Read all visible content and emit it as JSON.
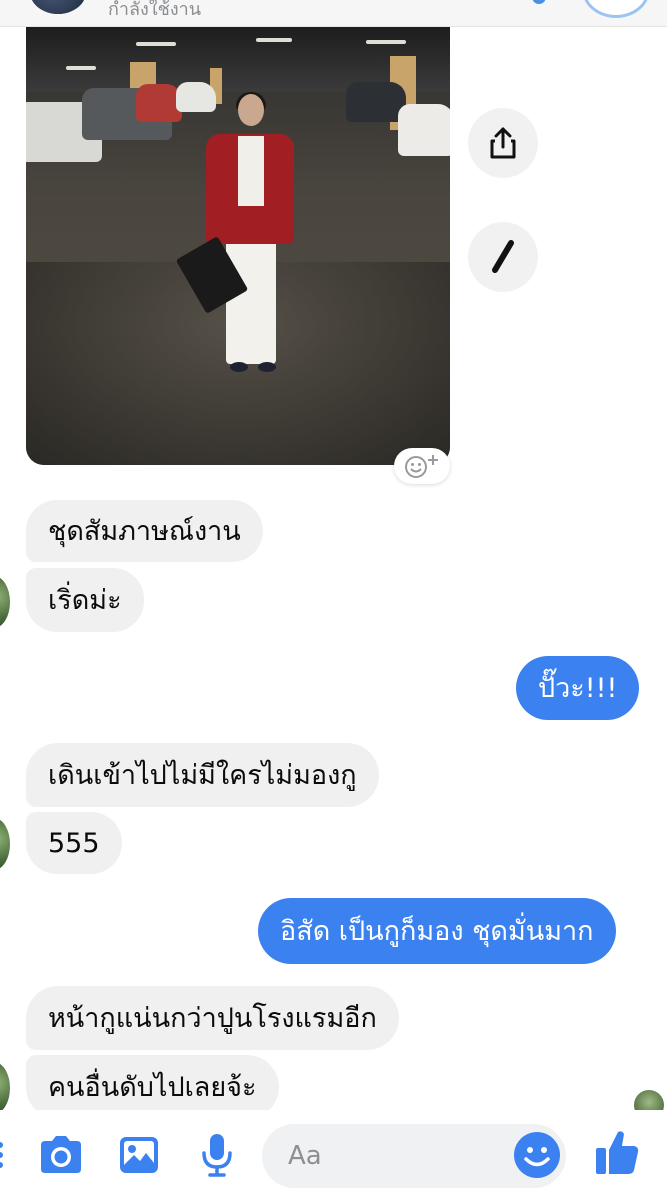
{
  "header": {
    "status_text": "กำลังใช้งาน"
  },
  "photo": {
    "description_icon": "photo-image"
  },
  "actions": {
    "share_icon": "share-icon",
    "edit_icon": "pencil-icon",
    "react_icon": "add-reaction-icon"
  },
  "messages": [
    {
      "from": "them",
      "text": "ชุดสัมภาษณ์งาน"
    },
    {
      "from": "them",
      "text": "เริ่ดม่ะ"
    },
    {
      "from": "me",
      "text": "ปั๊วะ!!!"
    },
    {
      "from": "them",
      "text": "เดินเข้าไปไม่มีใครไม่มองกู"
    },
    {
      "from": "them",
      "text": "555"
    },
    {
      "from": "me",
      "text": "อิสัด เป็นกูก็มอง ชุดมั่นมาก"
    },
    {
      "from": "them",
      "text": "หน้ากูแน่นกว่าปูนโรงแรมอีก"
    },
    {
      "from": "them",
      "text": "คนอื่นดับไปเลยจ้ะ"
    }
  ],
  "composer": {
    "placeholder": "Aa",
    "icons": [
      "camera-icon",
      "gallery-icon",
      "microphone-icon",
      "emoji-icon",
      "thumbs-up-icon"
    ]
  },
  "colors": {
    "accent": "#3b82f0",
    "incoming_bubble": "#f0f0f0"
  }
}
